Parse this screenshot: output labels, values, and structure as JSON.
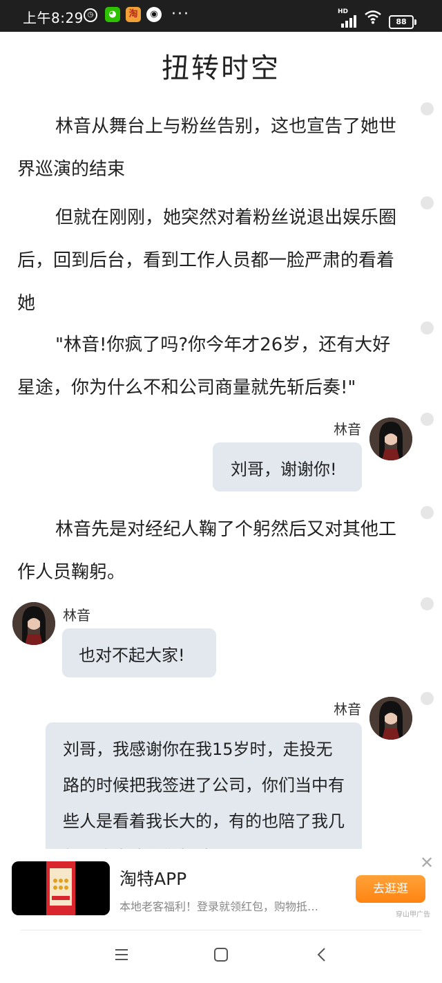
{
  "status_bar": {
    "time": "上午8:29",
    "more": "···",
    "hd": "HD",
    "battery": "88"
  },
  "article": {
    "title": "扭转时空",
    "paragraphs": [
      "林音从舞台上与粉丝告别，这也宣告了她世界巡演的结束",
      "但就在刚刚，她突然对着粉丝说退出娱乐圈后，回到后台，看到工作人员都一脸严肃的看着她",
      "\"林音!你疯了吗?你今年才26岁，还有大好星途，你为什么不和公司商量就先斩后奏!\"",
      "林音先是对经纪人鞠了个躬然后又对其他工作人员鞠躬。"
    ],
    "dialogs": [
      {
        "speaker": "林音",
        "text": "刘哥，谢谢你!"
      },
      {
        "speaker": "林音",
        "text": "也对不起大家!"
      },
      {
        "speaker": "林音",
        "text": "刘哥，我感谢你在我15岁时，走投无路的时候把我签进了公司，你们当中有些人是看着我长大的，有的也陪了我几年，我也沈你们打认"
      }
    ]
  },
  "ad": {
    "title": "淘特APP",
    "description": "本地老客福利！登录就领红包，购物抵…",
    "button": "去逛逛",
    "source": "穿山甲广告",
    "close": "✕"
  }
}
